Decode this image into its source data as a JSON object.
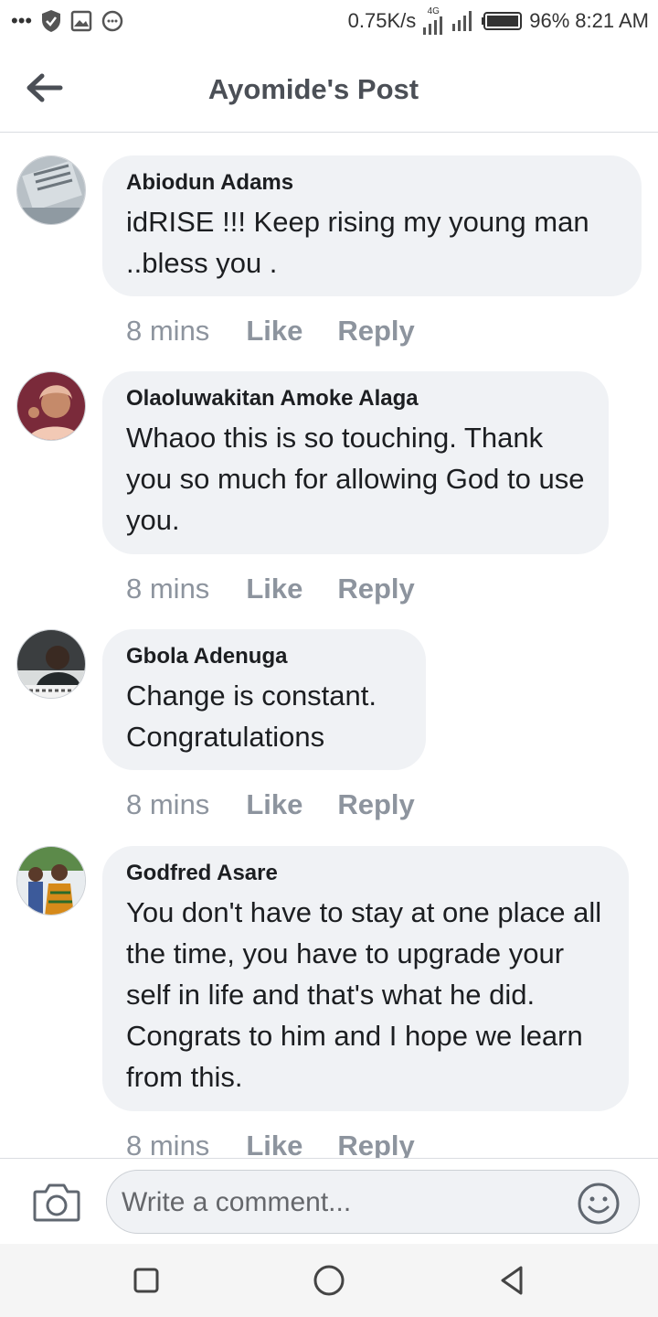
{
  "status_bar": {
    "speed": "0.75K/s",
    "network": "4G",
    "battery": "96%",
    "time": "8:21 AM"
  },
  "header": {
    "title": "Ayomide's Post"
  },
  "comments": [
    {
      "author": "Abiodun Adams",
      "text": "idRISE !!! Keep rising my young man ..bless you .",
      "time": "8 mins",
      "like_label": "Like",
      "reply_label": "Reply"
    },
    {
      "author": "Olaoluwakitan Amoke Alaga",
      "text": "Whaoo this is so touching. Thank you so much for allowing God to use you.",
      "time": "8 mins",
      "like_label": "Like",
      "reply_label": "Reply"
    },
    {
      "author": "Gbola Adenuga",
      "text": "Change is constant. Congratulations",
      "time": "8 mins",
      "like_label": "Like",
      "reply_label": "Reply"
    },
    {
      "author": "Godfred Asare",
      "text": "You don't have to stay at one place all the time, you have to upgrade your self in life and that's what he did. Congrats to him and I hope we learn from this.",
      "time": "8 mins",
      "like_label": "Like",
      "reply_label": "Reply"
    }
  ],
  "composer": {
    "placeholder": "Write a comment...",
    "camera_icon": "camera-icon",
    "emoji_icon": "emoji-icon"
  },
  "nav": {
    "recents_icon": "square-icon",
    "home_icon": "circle-icon",
    "back_icon": "triangle-back-icon"
  },
  "colors": {
    "bubble": "#f0f2f5",
    "meta": "#8d949e",
    "title": "#4b4f56"
  }
}
